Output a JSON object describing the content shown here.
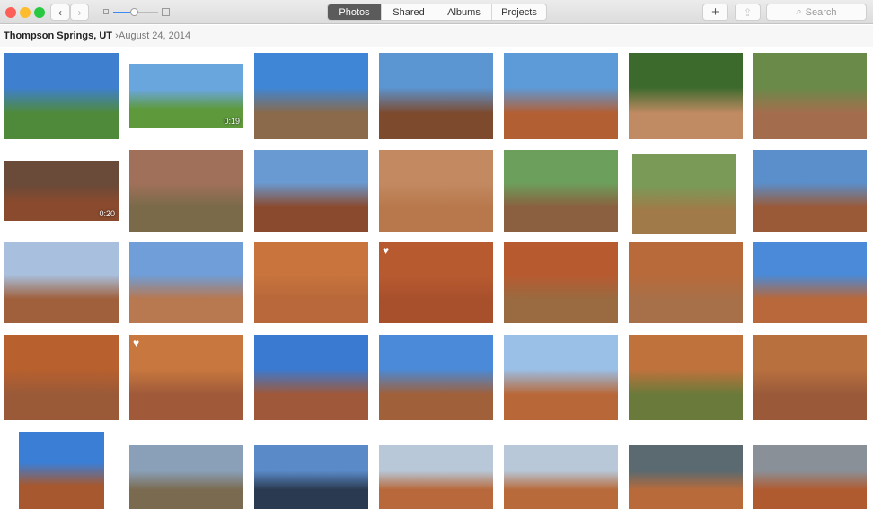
{
  "window": {
    "controls": [
      "close",
      "minimize",
      "zoom"
    ]
  },
  "toolbar": {
    "back": "‹",
    "forward": "›",
    "tabs": [
      {
        "label": "Photos",
        "active": true
      },
      {
        "label": "Shared"
      },
      {
        "label": "Albums"
      },
      {
        "label": "Projects"
      }
    ],
    "add": "+",
    "share": "⇪",
    "search_placeholder": "Search",
    "zoom_level": 0.45
  },
  "breadcrumb": {
    "location": "Thompson Springs, UT",
    "separator": "›",
    "date": "August 24, 2014"
  },
  "photos": [
    {
      "sky": "#3e7fd0",
      "ground": "#4f8a3a"
    },
    {
      "sky": "#6aa6de",
      "ground": "#5e9a3c",
      "duration": "0:19"
    },
    {
      "sky": "#3f86d6",
      "ground": "#8a6a4a"
    },
    {
      "sky": "#5b95d2",
      "ground": "#7d4a2e"
    },
    {
      "sky": "#5d9ad8",
      "ground": "#b35f34"
    },
    {
      "sky": "#3c6a2d",
      "ground": "#c08a63"
    },
    {
      "sky": "#6a8a4a",
      "ground": "#a36d4d"
    },
    {
      "sky": "#6a4a38",
      "ground": "#8a4a2e",
      "duration": "0:20"
    },
    {
      "sky": "#a1705a",
      "ground": "#7a6a4a"
    },
    {
      "sky": "#6a9ad2",
      "ground": "#8a4a2e"
    },
    {
      "sky": "#c38a62",
      "ground": "#b8784c"
    },
    {
      "sky": "#6c9f5c",
      "ground": "#8a6040"
    },
    {
      "sky": "#7a9a58",
      "ground": "#a07a48"
    },
    {
      "sky": "#5a8fcc",
      "ground": "#9a5a38"
    },
    {
      "sky": "#a8c0de",
      "ground": "#a0603c"
    },
    {
      "sky": "#6f9ed8",
      "ground": "#b87850"
    },
    {
      "sky": "#c8743c",
      "ground": "#b8683a"
    },
    {
      "sky": "#b85a30",
      "ground": "#a8502c",
      "favorite": true
    },
    {
      "sky": "#b85a30",
      "ground": "#9a6a40"
    },
    {
      "sky": "#b86a3a",
      "ground": "#a87048"
    },
    {
      "sky": "#4a8ad8",
      "ground": "#b8683a"
    },
    {
      "sky": "#b8602e",
      "ground": "#9a5a38"
    },
    {
      "sky": "#c8783e",
      "ground": "#a05a3a",
      "favorite": true
    },
    {
      "sky": "#3a7ad0",
      "ground": "#a0583a"
    },
    {
      "sky": "#4a8ad8",
      "ground": "#a0603a"
    },
    {
      "sky": "#9ac0e8",
      "ground": "#b86838"
    },
    {
      "sky": "#c0723c",
      "ground": "#6a7a3a"
    },
    {
      "sky": "#b8703e",
      "ground": "#9a5a3a"
    },
    {
      "sky": "#3a7ed6",
      "ground": "#a8582e"
    },
    {
      "sky": "#8aa0b8",
      "ground": "#7a6a50"
    },
    {
      "sky": "#5a8ac8",
      "ground": "#2a3a50"
    },
    {
      "sky": "#b8c8d8",
      "ground": "#b8683a"
    },
    {
      "sky": "#b8c8d8",
      "ground": "#b86a3a"
    },
    {
      "sky": "#5a6a70",
      "ground": "#b86a3a"
    },
    {
      "sky": "#8a9098",
      "ground": "#b05a30"
    }
  ]
}
